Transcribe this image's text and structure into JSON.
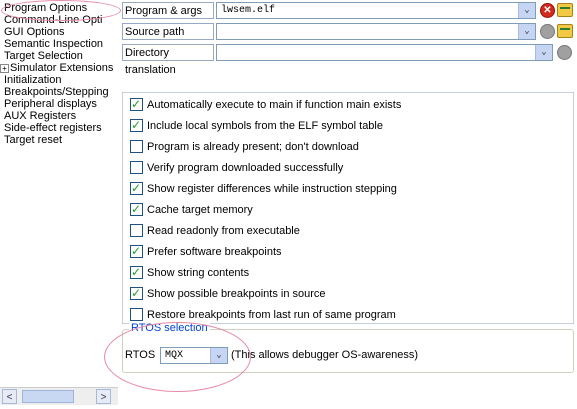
{
  "tree": {
    "items": [
      {
        "label": "Program Options",
        "expandable": false
      },
      {
        "label": "Command-Line Opti",
        "expandable": false
      },
      {
        "label": "GUI Options",
        "expandable": false
      },
      {
        "label": "Semantic Inspection",
        "expandable": false
      },
      {
        "label": "Target Selection",
        "expandable": false
      },
      {
        "label": "Simulator Extensions",
        "expandable": true,
        "expander": "+"
      },
      {
        "label": "Initialization",
        "expandable": false
      },
      {
        "label": "Breakpoints/Stepping",
        "expandable": false
      },
      {
        "label": "Peripheral displays",
        "expandable": false
      },
      {
        "label": "AUX Registers",
        "expandable": false
      },
      {
        "label": "Side-effect registers",
        "expandable": false
      },
      {
        "label": "Target reset",
        "expandable": false
      }
    ],
    "scroll_left_icon": "<",
    "scroll_right_icon": ">"
  },
  "fields": {
    "program_args": {
      "label": "Program & args",
      "value": "lwsem.elf"
    },
    "source_path": {
      "label": "Source path",
      "value": ""
    },
    "directory_translation": {
      "label": "Directory translation",
      "value": ""
    },
    "dropdown_glyph": "⌄",
    "delete_glyph": "✕"
  },
  "options": [
    {
      "label": "Automatically execute to main if function main exists",
      "checked": true
    },
    {
      "label": "Include local symbols from the ELF symbol table",
      "checked": true
    },
    {
      "label": "Program is already present; don't download",
      "checked": false
    },
    {
      "label": "Verify program downloaded successfully",
      "checked": false
    },
    {
      "label": "Show register differences while instruction stepping",
      "checked": true
    },
    {
      "label": "Cache target memory",
      "checked": true
    },
    {
      "label": "Read readonly from executable",
      "checked": false
    },
    {
      "label": "Prefer software breakpoints",
      "checked": true
    },
    {
      "label": "Show string contents",
      "checked": true
    },
    {
      "label": "Show possible breakpoints in source",
      "checked": true
    },
    {
      "label": "Restore breakpoints from last run of same program",
      "checked": false
    }
  ],
  "rtos": {
    "group_title": "RTOS selection",
    "label": "RTOS",
    "value": "MQX",
    "hint": "(This allows debugger OS-awareness)"
  },
  "colors": {
    "highlight_ellipse": "#e88aa7",
    "group_title": "#0046d5",
    "check": "#21a121"
  }
}
